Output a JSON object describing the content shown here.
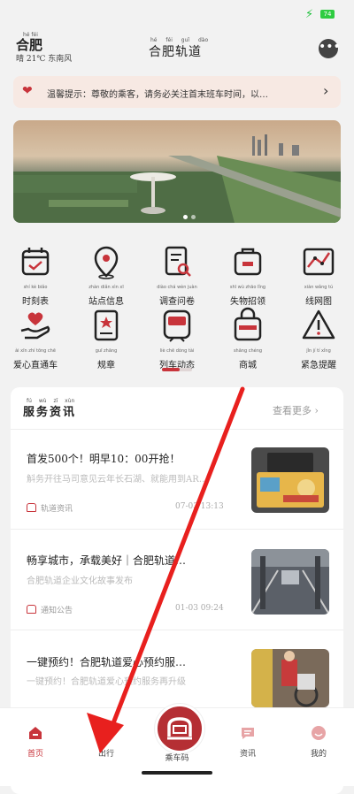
{
  "status": {
    "battery": "74"
  },
  "header": {
    "city": "合肥",
    "city_pinyin": "hé féi",
    "weather": "晴 21℃ 东南风",
    "title": "合肥轨道",
    "title_pinyin": "hé féi guǐ dào",
    "more_icon": "ellipsis-icon"
  },
  "notice": {
    "text": "温馨提示：尊敬的乘客，请务必关注首末班车时间，以…",
    "icon": "heart-icon"
  },
  "banner": {
    "slides": 2,
    "active": 1
  },
  "services": [
    {
      "label": "时刻表",
      "pinyin": "shí kè biǎo",
      "icon": "calendar-icon"
    },
    {
      "label": "站点信息",
      "pinyin": "zhàn diǎn xìn xī",
      "icon": "location-pin-icon"
    },
    {
      "label": "调查问卷",
      "pinyin": "diào chá wèn juàn",
      "icon": "survey-icon"
    },
    {
      "label": "失物招领",
      "pinyin": "shī wù zhāo lǐng",
      "icon": "lost-found-icon"
    },
    {
      "label": "线网图",
      "pinyin": "xiàn wǎng tú",
      "icon": "network-map-icon"
    },
    {
      "label": "爱心直通车",
      "pinyin": "ài xīn zhí tōng chē",
      "icon": "heart-hand-icon"
    },
    {
      "label": "规章",
      "pinyin": "guī zhāng",
      "icon": "regulation-icon"
    },
    {
      "label": "列车动态",
      "pinyin": "liè chē dòng tài",
      "icon": "train-icon"
    },
    {
      "label": "商城",
      "pinyin": "shāng chéng",
      "icon": "shopping-bag-icon"
    },
    {
      "label": "紧急提醒",
      "pinyin": "jǐn jí tí xǐng",
      "icon": "warning-icon"
    }
  ],
  "news": {
    "heading": "服务资讯",
    "heading_pinyin": "fú wù zī xùn",
    "more": "查看更多 ›",
    "articles": [
      {
        "title": "首发500个！明早10：00开抢！",
        "subtitle": "斛务开往马司意见云年长石湖、就能用到AR…",
        "category": "轨道资讯",
        "date": "07-03 13:13"
      },
      {
        "title": "畅享城市，承载美好｜合肥轨道…",
        "subtitle": "合肥轨道企业文化故事发布",
        "category": "通知公告",
        "date": "01-03 09:24"
      },
      {
        "title": "一键预约！合肥轨道爱心预约服…",
        "subtitle": "一键预约！合肥轨道爱心预约服务再升级",
        "category": "",
        "date": ""
      }
    ]
  },
  "tabbar": {
    "items": [
      {
        "label": "首页",
        "icon": "home-icon",
        "active": true
      },
      {
        "label": "出行",
        "icon": "travel-icon",
        "active": false
      },
      {
        "label": "乘车码",
        "icon": "metro-qr-icon",
        "active": false
      },
      {
        "label": "资讯",
        "icon": "message-icon",
        "active": false
      },
      {
        "label": "我的",
        "icon": "profile-icon",
        "active": false
      }
    ]
  },
  "colors": {
    "accent": "#c8343b",
    "annotation_arrow": "#e8201e"
  }
}
